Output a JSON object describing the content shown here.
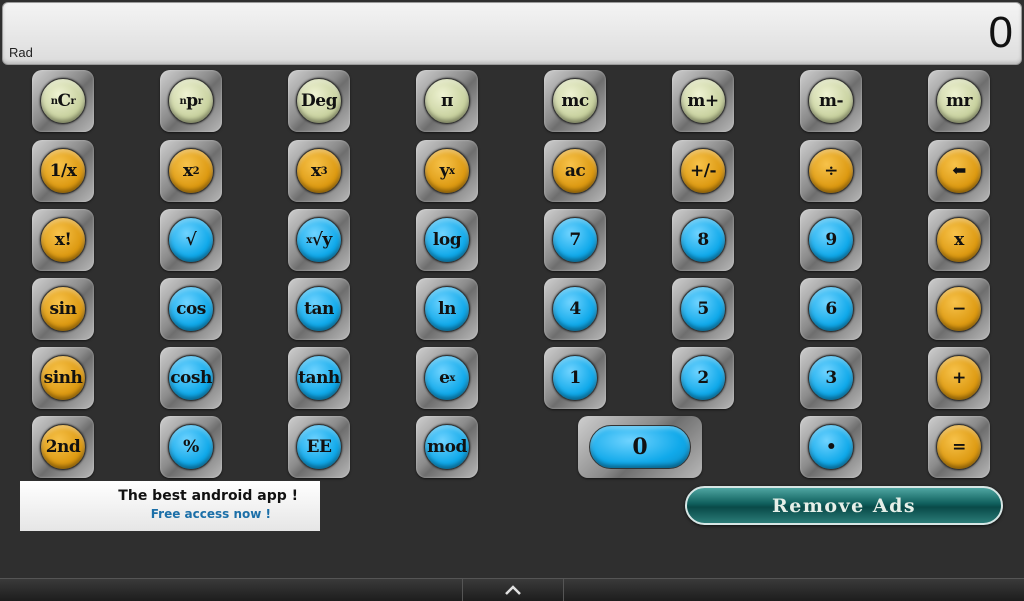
{
  "display": {
    "mode": "Rad",
    "value": "0"
  },
  "colors": {
    "lime": "#c9d2a0",
    "orange": "#dd9a12",
    "blue": "#10a9ea",
    "remove_ads": "#0f5f5c"
  },
  "keys": {
    "ncr": "C",
    "npr": "p",
    "deg": "Deg",
    "pi": "π",
    "mc": "mc",
    "mplus": "m+",
    "mminus": "m-",
    "mr": "mr",
    "recip": "1/x",
    "sq_base": "x",
    "cube_base": "x",
    "pow_base": "y",
    "ac": "ac",
    "sign": "+/-",
    "div": "÷",
    "back": "⬅",
    "fact": "x!",
    "sqrt": "√",
    "xroot_base": "√y",
    "log": "log",
    "d7": "7",
    "d8": "8",
    "d9": "9",
    "mul": "x",
    "sin": "sin",
    "cos": "cos",
    "tan": "tan",
    "ln": "ln",
    "d4": "4",
    "d5": "5",
    "d6": "6",
    "minus": "−",
    "sinh": "sinh",
    "cosh": "cosh",
    "tanh": "tanh",
    "exp_base": "e",
    "d1": "1",
    "d2": "2",
    "d3": "3",
    "plus": "+",
    "second": "2nd",
    "percent": "%",
    "ee": "EE",
    "mod": "mod",
    "d0": "0",
    "dot": "•",
    "equals": "="
  },
  "key_marks": {
    "n": "n",
    "r": "r",
    "two": "2",
    "three": "3",
    "x": "x"
  },
  "ad": {
    "line1": "The best android app !",
    "line2": "Free access now !"
  },
  "remove_ads_label": "Remove Ads",
  "nav": {
    "handle_icon": "chevron-up-icon"
  }
}
